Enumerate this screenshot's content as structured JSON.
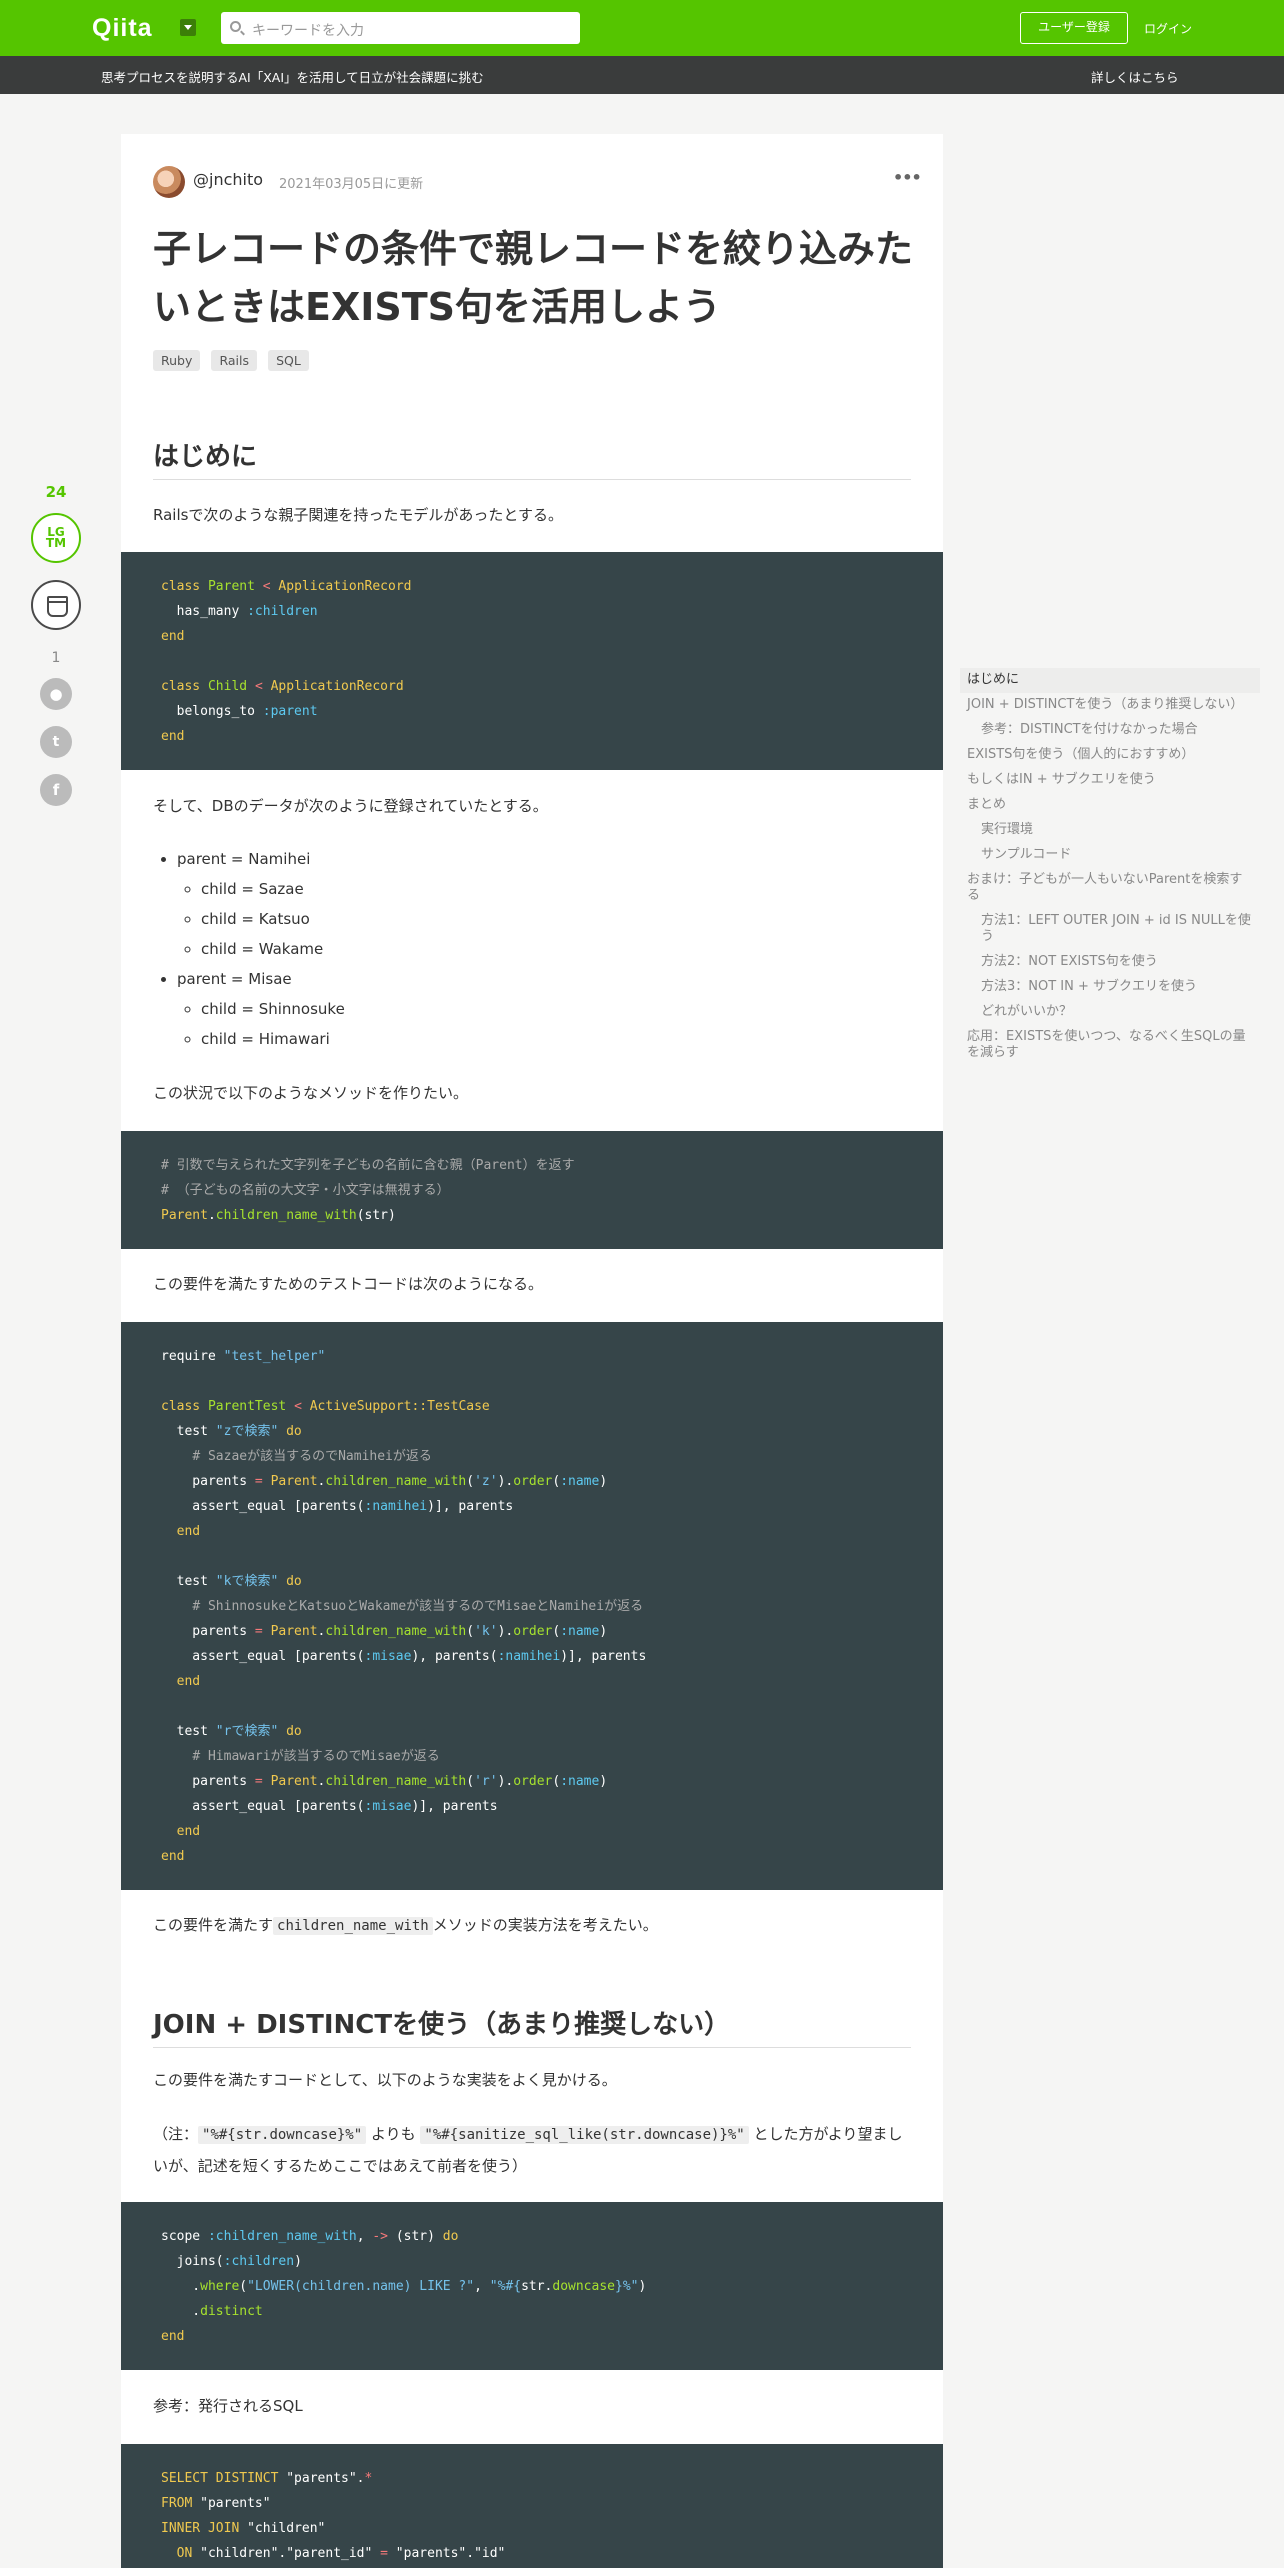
{
  "header": {
    "logo": "Qiita",
    "search_placeholder": "キーワードを入力",
    "signup_label": "ユーザー登録",
    "login_label": "ログイン"
  },
  "banner": {
    "message": "思考プロセスを説明するAI「XAI」を活用して日立が社会課題に挑む",
    "link": "詳しくはこちら"
  },
  "rail": {
    "lgtm_count": "24",
    "lgtm_label_1": "LG",
    "lgtm_label_2": "TM",
    "comment_count": "1"
  },
  "article": {
    "username": "@jnchito",
    "updated": "2021年03月05日に更新",
    "menu": "•••",
    "title": "子レコードの条件で親レコードを絞り込みたいときはEXISTS句を活用しよう",
    "tags": [
      "Ruby",
      "Rails",
      "SQL"
    ],
    "h_intro": "はじめに",
    "p1": "Railsで次のような親子関連を持ったモデルがあったとする。",
    "p2": "そして、DBのデータが次のように登録されていたとする。",
    "parent1": "parent = Namihei",
    "children1": [
      "child = Sazae",
      "child = Katsuo",
      "child = Wakame"
    ],
    "parent2": "parent = Misae",
    "children2": [
      "child = Shinnosuke",
      "child = Himawari"
    ],
    "p3": "この状況で以下のようなメソッドを作りたい。",
    "p4": "この要件を満たすためのテストコードは次のようになる。",
    "p5_a": "この要件を満たす",
    "p5_code": "children_name_with",
    "p5_b": "メソッドの実装方法を考えたい。",
    "h_join": "JOIN + DISTINCTを使う（あまり推奨しない）",
    "p6": "この要件を満たすコードとして、以下のような実装をよく見かける。",
    "p7_a": "（注：",
    "p7_code1": "\"%#{str.downcase}%\"",
    "p7_b": " よりも ",
    "p7_code2": "\"%#{sanitize_sql_like(str.downcase)}%\"",
    "p7_c": " とした方がより望ましいが、記述を短くするためここではあえて前者を使う）",
    "p8": "参考：発行されるSQL"
  },
  "toc": [
    {
      "label": "はじめに",
      "level": 1,
      "active": true
    },
    {
      "label": "JOIN + DISTINCTを使う（あまり推奨しない）",
      "level": 1
    },
    {
      "label": "参考：DISTINCTを付けなかった場合",
      "level": 2
    },
    {
      "label": "EXISTS句を使う（個人的におすすめ）",
      "level": 1
    },
    {
      "label": "もしくはIN + サブクエリを使う",
      "level": 1
    },
    {
      "label": "まとめ",
      "level": 1
    },
    {
      "label": "実行環境",
      "level": 2
    },
    {
      "label": "サンプルコード",
      "level": 2
    },
    {
      "label": "おまけ：子どもが一人もいないParentを検索する",
      "level": 1
    },
    {
      "label": "方法1：LEFT OUTER JOIN + id IS NULLを使う",
      "level": 2
    },
    {
      "label": "方法2：NOT EXISTS句を使う",
      "level": 2
    },
    {
      "label": "方法3：NOT IN + サブクエリを使う",
      "level": 2
    },
    {
      "label": "どれがいいか？",
      "level": 2
    },
    {
      "label": "応用：EXISTSを使いつつ、なるべく生SQLの量を減らす",
      "level": 1
    }
  ],
  "code_blocks": {
    "models": [
      "class Parent < ApplicationRecord",
      "  has_many :children",
      "end",
      "",
      "class Child < ApplicationRecord",
      "  belongs_to :parent",
      "end"
    ],
    "method": [
      "# 引数で与えられた文字列を子どもの名前に含む親（Parent）を返す",
      "# （子どもの名前の大文字・小文字は無視する）",
      "Parent.children_name_with(str)"
    ],
    "test": [
      "require \"test_helper\"",
      "",
      "class ParentTest < ActiveSupport::TestCase",
      "  test \"zで検索\" do",
      "    # Sazaeが該当するのでNamiheiが返る",
      "    parents = Parent.children_name_with('z').order(:name)",
      "    assert_equal [parents(:namihei)], parents",
      "  end",
      "",
      "  test \"kで検索\" do",
      "    # ShinnosukeとKatsuoとWakameが該当するのでMisaeとNamiheiが返る",
      "    parents = Parent.children_name_with('k').order(:name)",
      "    assert_equal [parents(:misae), parents(:namihei)], parents",
      "  end",
      "",
      "  test \"rで検索\" do",
      "    # Himawariが該当するのでMisaeが返る",
      "    parents = Parent.children_name_with('r').order(:name)",
      "    assert_equal [parents(:misae)], parents",
      "  end",
      "end"
    ],
    "scope": [
      "scope :children_name_with, -> (str) do",
      "  joins(:children)",
      "    .where(\"LOWER(children.name) LIKE ?\", \"%#{str.downcase}%\")",
      "    .distinct",
      "end"
    ],
    "sql": [
      "SELECT DISTINCT \"parents\".*",
      "FROM \"parents\"",
      "INNER JOIN \"children\"",
      "  ON \"children\".\"parent_id\" = \"parents\".\"id\""
    ]
  },
  "colors": {
    "brand": "#55c500",
    "banner": "#3a3c3c",
    "code_bg": "#364549"
  }
}
